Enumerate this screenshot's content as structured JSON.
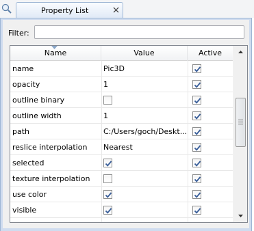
{
  "tab": {
    "title": "Property List"
  },
  "filter": {
    "label": "Filter:",
    "value": "",
    "placeholder": ""
  },
  "table": {
    "columns": [
      "Name",
      "Value",
      "Active"
    ],
    "rows": [
      {
        "name": "name",
        "value_text": "Pic3D",
        "value_checkbox": null,
        "active": true
      },
      {
        "name": "opacity",
        "value_text": "1",
        "value_checkbox": null,
        "active": true
      },
      {
        "name": "outline binary",
        "value_text": "",
        "value_checkbox": false,
        "active": true
      },
      {
        "name": "outline width",
        "value_text": "1",
        "value_checkbox": null,
        "active": true
      },
      {
        "name": "path",
        "value_text": "C:/Users/goch/Deskt...",
        "value_checkbox": null,
        "active": true
      },
      {
        "name": "reslice interpolation",
        "value_text": "Nearest",
        "value_checkbox": null,
        "active": true
      },
      {
        "name": "selected",
        "value_text": "",
        "value_checkbox": true,
        "active": true
      },
      {
        "name": "texture interpolation",
        "value_text": "",
        "value_checkbox": false,
        "active": true
      },
      {
        "name": "use color",
        "value_text": "",
        "value_checkbox": true,
        "active": true
      },
      {
        "name": "visible",
        "value_text": "",
        "value_checkbox": true,
        "active": true
      }
    ]
  },
  "icons": {
    "search": "search-icon",
    "close": "close-icon",
    "sort": "sort-arrow-icon"
  },
  "colors": {
    "accent": "#9eb6d4",
    "panel_bg": "#cfdcef",
    "check": "#3a5f9a"
  }
}
